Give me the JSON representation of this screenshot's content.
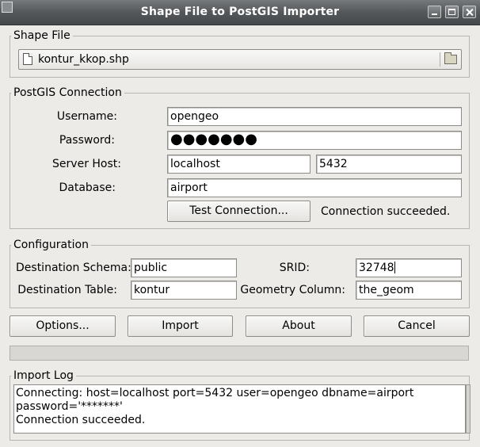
{
  "window": {
    "title": "Shape File to PostGIS Importer",
    "controls": [
      "minimize-icon",
      "maximize-icon",
      "close-icon"
    ]
  },
  "shape_file": {
    "section_label": "Shape File",
    "filename": "kontur_kkop.shp",
    "file_icon": "document-icon",
    "browse_icon": "folder-icon"
  },
  "connection": {
    "section_label": "PostGIS Connection",
    "username_label": "Username:",
    "username_value": "opengeo",
    "password_label": "Password:",
    "password_value": "●●●●●●●",
    "host_label": "Server Host:",
    "host_value": "localhost",
    "port_value": "5432",
    "database_label": "Database:",
    "database_value": "airport",
    "test_button": "Test Connection...",
    "status": "Connection succeeded."
  },
  "configuration": {
    "section_label": "Configuration",
    "schema_label": "Destination Schema:",
    "schema_value": "public",
    "srid_label": "SRID:",
    "srid_value": "32748",
    "table_label": "Destination Table:",
    "table_value": "kontur",
    "geom_label": "Geometry Column:",
    "geom_value": "the_geom"
  },
  "actions": {
    "options": "Options...",
    "import": "Import",
    "about": "About",
    "cancel": "Cancel"
  },
  "progress": {
    "fraction": 0.0
  },
  "log": {
    "section_label": "Import Log",
    "lines": [
      "Connecting:  host=localhost port=5432 user=opengeo dbname=airport",
      "password='*******'",
      "Connection succeeded."
    ]
  },
  "colors": {
    "titlebar": "#55585b",
    "progress_fill": "#7da0d0",
    "window_bg": "#ecebe8"
  }
}
